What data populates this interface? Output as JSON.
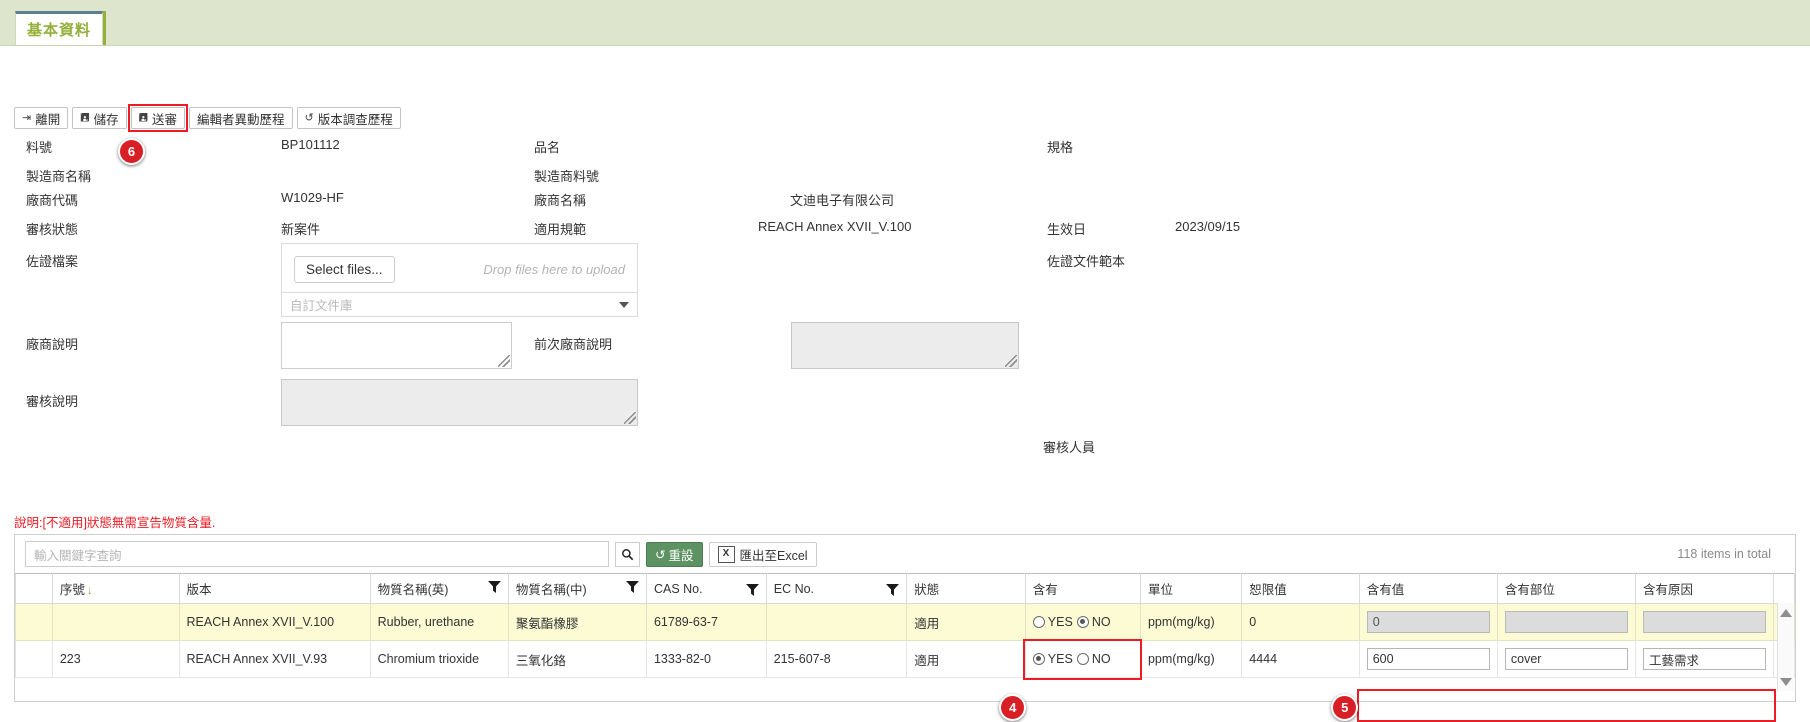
{
  "tab": {
    "label": "基本資料"
  },
  "toolbar": {
    "buttons": [
      {
        "label": "離開",
        "icon": "exit-icon",
        "glyph": "➡",
        "highlight": false
      },
      {
        "label": "儲存",
        "icon": "save-icon",
        "glyph": "💾",
        "highlight": false
      },
      {
        "label": "送審",
        "icon": "submit-icon",
        "glyph": "💾",
        "highlight": true
      },
      {
        "label": "編輯者異動歷程",
        "icon": "history-icon",
        "glyph": "",
        "highlight": false
      },
      {
        "label": "版本調查歷程",
        "icon": "revision-history-icon",
        "glyph": "↺",
        "highlight": false
      }
    ]
  },
  "callouts": {
    "six": "6",
    "four": "4",
    "five": "5"
  },
  "form": {
    "material_no_label": "料號",
    "material_no_value": "BP101112",
    "product_name_label": "品名",
    "product_name_value": "",
    "spec_label": "規格",
    "spec_value": "",
    "maker_name_label": "製造商名稱",
    "maker_name_value": "",
    "maker_part_label": "製造商料號",
    "maker_part_value": "",
    "vendor_code_label": "廠商代碼",
    "vendor_code_value": "W1029-HF",
    "vendor_name_label": "廠商名稱",
    "vendor_name_value": "文迪电子有限公司",
    "review_status_label": "審核狀態",
    "review_status_value": "新案件",
    "regulation_label": "適用規範",
    "regulation_value": "REACH Annex XVII_V.100",
    "effective_date_label": "生效日",
    "effective_date_value": "2023/09/15",
    "evidence_file_label": "佐證檔案",
    "evidence_template_label": "佐證文件範本",
    "select_files_label": "Select files...",
    "drop_hint": "Drop files here to upload",
    "doc_library_placeholder": "自訂文件庫",
    "vendor_note_label": "廠商說明",
    "vendor_note_value": "",
    "prev_vendor_note_label": "前次廠商說明",
    "prev_vendor_note_value": "",
    "review_note_label": "審核說明",
    "review_note_value": "",
    "reviewer_label": "審核人員",
    "reviewer_value": ""
  },
  "note": "說明:[不適用]狀態無需宣告物質含量.",
  "grid_toolbar": {
    "search_placeholder": "輸入關鍵字查詢",
    "search_value": "",
    "search_icon": "search-icon",
    "reset_label": "重設",
    "export_label": "匯出至Excel",
    "total_label": "118 items in total"
  },
  "table": {
    "columns": [
      {
        "key": "check",
        "label": "",
        "filter": false,
        "sort": false
      },
      {
        "key": "seq",
        "label": "序號",
        "filter": false,
        "sort": true
      },
      {
        "key": "version",
        "label": "版本",
        "filter": false,
        "sort": false
      },
      {
        "key": "name_en",
        "label": "物質名稱(英)",
        "filter": true,
        "sort": false
      },
      {
        "key": "name_zh",
        "label": "物質名稱(中)",
        "filter": true,
        "sort": false
      },
      {
        "key": "cas",
        "label": "CAS No.",
        "filter": true,
        "sort": false
      },
      {
        "key": "ec",
        "label": "EC No.",
        "filter": true,
        "sort": false
      },
      {
        "key": "status",
        "label": "狀態",
        "filter": true,
        "sort": false
      },
      {
        "key": "contain",
        "label": "含有",
        "filter": false,
        "sort": false
      },
      {
        "key": "unit",
        "label": "單位",
        "filter": false,
        "sort": false
      },
      {
        "key": "limit",
        "label": "恕限值",
        "filter": false,
        "sort": false
      },
      {
        "key": "amount",
        "label": "含有值",
        "filter": false,
        "sort": false
      },
      {
        "key": "part",
        "label": "含有部位",
        "filter": false,
        "sort": false
      },
      {
        "key": "reason",
        "label": "含有原因",
        "filter": false,
        "sort": false
      }
    ],
    "rows": [
      {
        "seq": "",
        "version": "REACH Annex XVII_V.100",
        "name_en": "Rubber, urethane",
        "name_zh": "聚氨酯橡膠",
        "cas": "61789-63-7",
        "ec": "",
        "status": "適用",
        "contain": "NO",
        "yes_label": "YES",
        "no_label": "NO",
        "unit": "ppm(mg/kg)",
        "limit": "0",
        "amount": "0",
        "part": "",
        "reason": "",
        "editable": false
      },
      {
        "seq": "223",
        "version": "REACH Annex XVII_V.93",
        "name_en": "Chromium trioxide",
        "name_zh": "三氧化鉻",
        "cas": "1333-82-0",
        "ec": "215-607-8",
        "status": "適用",
        "contain": "YES",
        "yes_label": "YES",
        "no_label": "NO",
        "unit": "ppm(mg/kg)",
        "limit": "4444",
        "amount": "600",
        "part": "cover",
        "reason": "工藝需求",
        "editable": true
      }
    ]
  },
  "colors": {
    "accent_green": "#93b03a",
    "tab_bg": "#dde6cd",
    "highlight_red": "#ee1b24",
    "row_yellow": "#fdfbd4",
    "button_green": "#5d9262"
  }
}
